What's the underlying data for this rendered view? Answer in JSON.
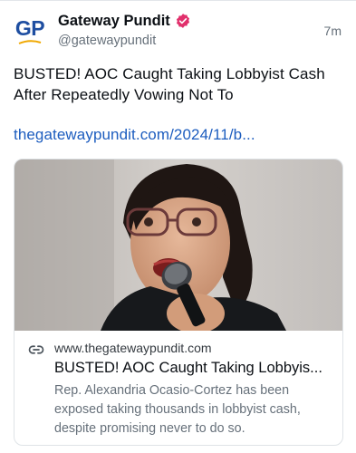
{
  "author": {
    "avatar_text": "GP",
    "display_name": "Gateway Pundit",
    "handle": "@gatewaypundit",
    "verified_icon": "verified-badge-icon",
    "badge_color": "#e1306c"
  },
  "post": {
    "time": "7m",
    "text": "BUSTED! AOC Caught Taking Lobbyist Cash After Repeatedly Vowing Not To",
    "link": "thegatewaypundit.com/2024/11/b..."
  },
  "card": {
    "icon": "link-icon",
    "domain": "www.thegatewaypundit.com",
    "title": "BUSTED! AOC Caught Taking Lobbyis...",
    "description": "Rep. Alexandria Ocasio-Cortez has been exposed taking thousands in lobbyist cash, despite promising never to do so."
  },
  "colors": {
    "link": "#1d5dbf",
    "brand_blue": "#1e4ea1",
    "muted_text": "#66707a"
  }
}
